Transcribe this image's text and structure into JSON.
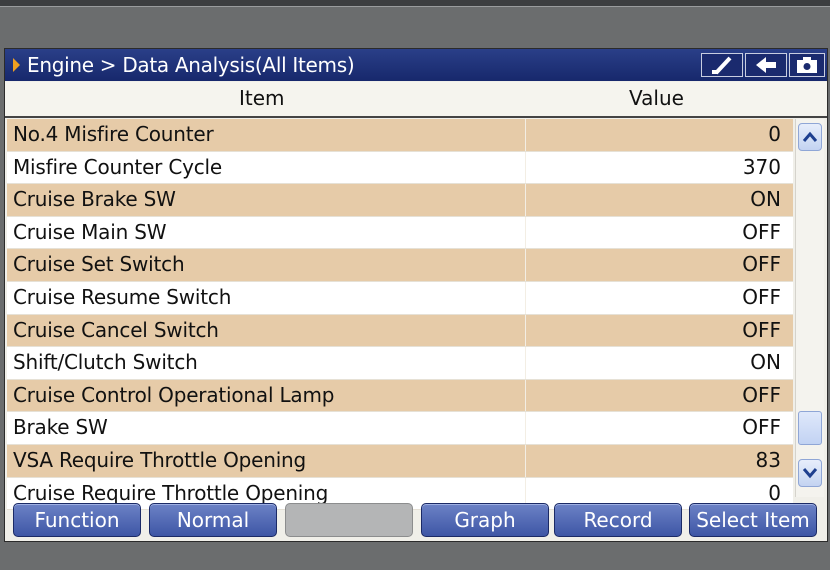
{
  "titlebar": {
    "title": "Engine > Data Analysis(All Items)",
    "icons": [
      "brush-icon",
      "back-arrow-icon",
      "camera-icon"
    ]
  },
  "columns": {
    "item": "Item",
    "value": "Value"
  },
  "rows": [
    {
      "name": "No.4 Misfire Counter",
      "value": "0"
    },
    {
      "name": "Misfire Counter Cycle",
      "value": "370"
    },
    {
      "name": "Cruise Brake SW",
      "value": "ON"
    },
    {
      "name": "Cruise Main SW",
      "value": "OFF"
    },
    {
      "name": "Cruise Set Switch",
      "value": "OFF"
    },
    {
      "name": "Cruise Resume Switch",
      "value": "OFF"
    },
    {
      "name": "Cruise Cancel Switch",
      "value": "OFF"
    },
    {
      "name": "Shift/Clutch Switch",
      "value": "ON"
    },
    {
      "name": "Cruise Control Operational Lamp",
      "value": "OFF"
    },
    {
      "name": "Brake SW",
      "value": "OFF"
    },
    {
      "name": "VSA Require Throttle Opening",
      "value": "83"
    },
    {
      "name": "Cruise Require Throttle Opening",
      "value": "0"
    }
  ],
  "buttons": {
    "function": "Function",
    "normal": "Normal",
    "blank": "",
    "graph": "Graph",
    "record": "Record",
    "select_item": "Select Item"
  },
  "colors": {
    "titlebar": "#1f3278",
    "row_alt": "#e6cba8",
    "button": "#4e66b2"
  }
}
